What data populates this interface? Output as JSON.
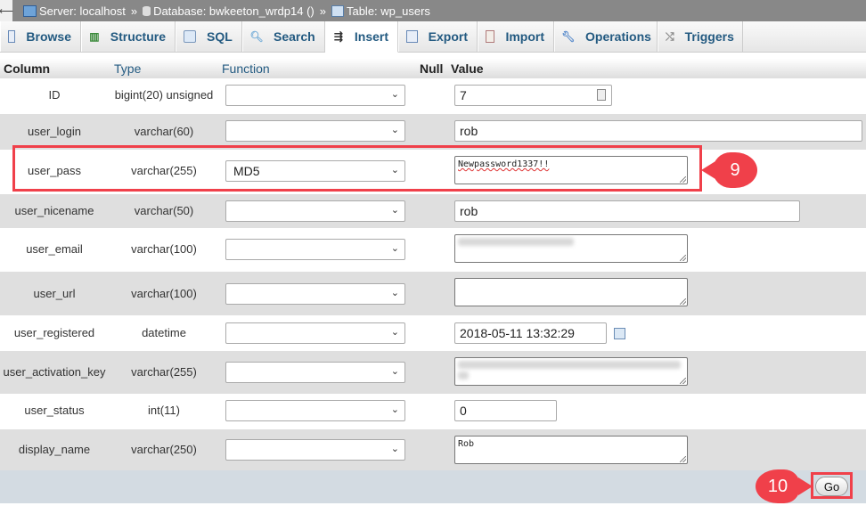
{
  "breadcrumb": {
    "server": "Server: localhost",
    "database": "Database: bwkeeton_wrdp14 ()",
    "table": "Table: wp_users",
    "separator": "»"
  },
  "tabs": [
    {
      "label": "Browse",
      "icon": "browse-icon",
      "active": false
    },
    {
      "label": "Structure",
      "icon": "structure-icon",
      "active": false
    },
    {
      "label": "SQL",
      "icon": "sql-icon",
      "active": false
    },
    {
      "label": "Search",
      "icon": "search-icon",
      "active": false
    },
    {
      "label": "Insert",
      "icon": "insert-icon",
      "active": true
    },
    {
      "label": "Export",
      "icon": "export-icon",
      "active": false
    },
    {
      "label": "Import",
      "icon": "import-icon",
      "active": false
    },
    {
      "label": "Operations",
      "icon": "wrench-icon",
      "active": false
    },
    {
      "label": "Triggers",
      "icon": "triggers-icon",
      "active": false
    }
  ],
  "headers": {
    "column": "Column",
    "type": "Type",
    "function": "Function",
    "null": "Null",
    "value": "Value"
  },
  "rows": [
    {
      "column": "ID",
      "type": "bigint(20) unsigned",
      "function": "",
      "value": "7",
      "value_kind": "number"
    },
    {
      "column": "user_login",
      "type": "varchar(60)",
      "function": "",
      "value": "rob",
      "value_kind": "text"
    },
    {
      "column": "user_pass",
      "type": "varchar(255)",
      "function": "MD5",
      "value": "Newpassword1337!!",
      "value_kind": "textarea"
    },
    {
      "column": "user_nicename",
      "type": "varchar(50)",
      "function": "",
      "value": "rob",
      "value_kind": "text"
    },
    {
      "column": "user_email",
      "type": "varchar(100)",
      "function": "",
      "value": "[redacted]",
      "value_kind": "textarea"
    },
    {
      "column": "user_url",
      "type": "varchar(100)",
      "function": "",
      "value": "",
      "value_kind": "textarea"
    },
    {
      "column": "user_registered",
      "type": "datetime",
      "function": "",
      "value": "2018-05-11 13:32:29",
      "value_kind": "datetime"
    },
    {
      "column": "user_activation_key",
      "type": "varchar(255)",
      "function": "",
      "value": "[redacted]",
      "value_kind": "textarea"
    },
    {
      "column": "user_status",
      "type": "int(11)",
      "function": "",
      "value": "0",
      "value_kind": "text"
    },
    {
      "column": "display_name",
      "type": "varchar(250)",
      "function": "",
      "value": "Rob",
      "value_kind": "textarea"
    }
  ],
  "go_label": "Go",
  "annotations": {
    "step_password": "9",
    "step_go": "10",
    "color": "#f0404a"
  }
}
